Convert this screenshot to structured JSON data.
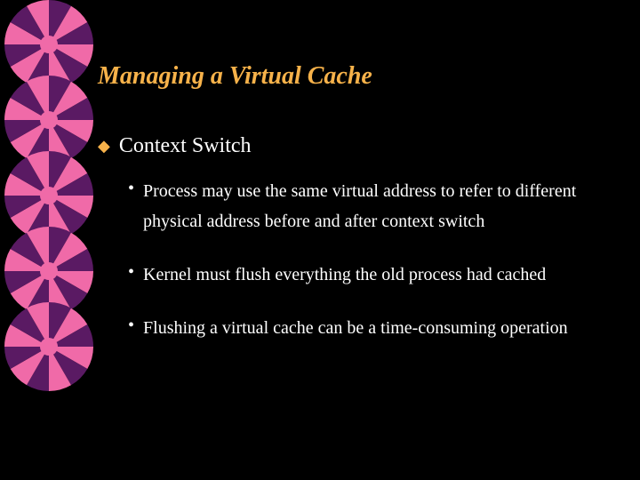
{
  "title": "Managing a Virtual Cache",
  "l1": {
    "bullet": "◆",
    "text": "Context Switch"
  },
  "l2": [
    {
      "dot": "•",
      "text": "Process may use the same virtual address to refer to different physical address before and after context switch"
    },
    {
      "dot": "•",
      "text": "Kernel must flush everything the old process had cached"
    },
    {
      "dot": "•",
      "text": "Flushing a virtual cache can be a time-consuming operation"
    }
  ]
}
